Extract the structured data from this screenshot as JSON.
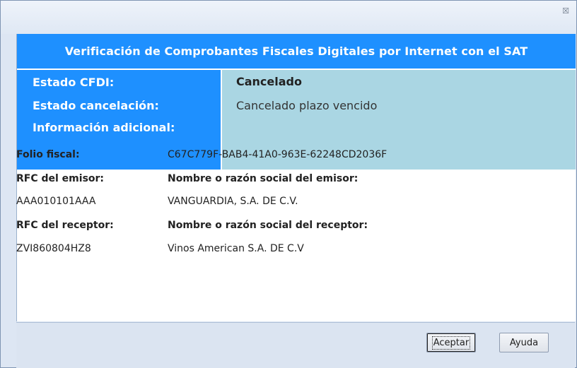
{
  "window": {
    "close_glyph": "☒"
  },
  "header": {
    "title": "Verificación de Comprobantes Fiscales Digitales por Internet con el SAT"
  },
  "status": {
    "label_estado_cfdi": "Estado CFDI:",
    "label_estado_cancelacion": "Estado cancelación:",
    "label_info_adicional": "Información adicional:",
    "value_estado_cfdi": "Cancelado",
    "value_estado_cancelacion": "Cancelado plazo vencido"
  },
  "details": {
    "folio_label": "Folio fiscal:",
    "folio_value": "C67C779F-BAB4-41A0-963E-62248CD2036F",
    "rfc_emisor_label": "RFC del emisor:",
    "nombre_emisor_label": "Nombre o razón social del emisor:",
    "rfc_emisor_value": "AAA010101AAA",
    "nombre_emisor_value": "VANGUARDIA, S.A. DE C.V.",
    "rfc_receptor_label": "RFC del receptor:",
    "nombre_receptor_label": "Nombre o razón social del receptor:",
    "rfc_receptor_value": "ZVI860804HZ8",
    "nombre_receptor_value": "Vinos American S.A. DE C.V"
  },
  "footer": {
    "accept_label": "Aceptar",
    "help_label": "Ayuda"
  }
}
